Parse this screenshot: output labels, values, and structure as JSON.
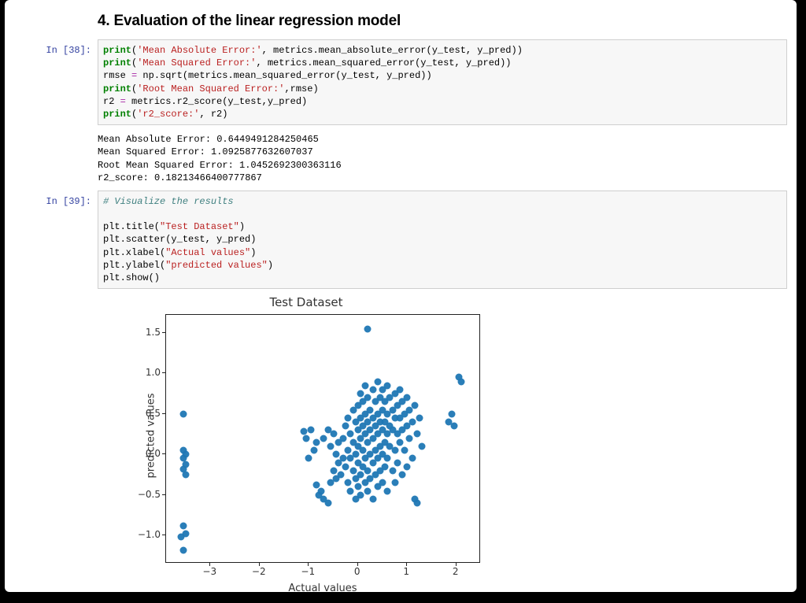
{
  "heading": "4. Evaluation of the linear regression model",
  "cells": {
    "c1": {
      "prompt": "In [38]:",
      "code_tokens": [
        {
          "t": "print",
          "c": "kw"
        },
        {
          "t": "("
        },
        {
          "t": "'Mean Absolute Error:'",
          "c": "str"
        },
        {
          "t": ", metrics.mean_absolute_error(y_test, y_pred))"
        },
        {
          "t": "\n"
        },
        {
          "t": "print",
          "c": "kw"
        },
        {
          "t": "("
        },
        {
          "t": "'Mean Squared Error:'",
          "c": "str"
        },
        {
          "t": ", metrics.mean_squared_error(y_test, y_pred))"
        },
        {
          "t": "\n"
        },
        {
          "t": "rmse "
        },
        {
          "t": "=",
          "c": "op"
        },
        {
          "t": " np.sqrt(metrics.mean_squared_error(y_test, y_pred))"
        },
        {
          "t": "\n"
        },
        {
          "t": "print",
          "c": "kw"
        },
        {
          "t": "("
        },
        {
          "t": "'Root Mean Squared Error:'",
          "c": "str"
        },
        {
          "t": ",rmse)"
        },
        {
          "t": "\n"
        },
        {
          "t": "r2 "
        },
        {
          "t": "=",
          "c": "op"
        },
        {
          "t": " metrics.r2_score(y_test,y_pred)"
        },
        {
          "t": "\n"
        },
        {
          "t": "print",
          "c": "kw"
        },
        {
          "t": "("
        },
        {
          "t": "'r2_score:'",
          "c": "str"
        },
        {
          "t": ", r2)"
        }
      ],
      "output_text": "Mean Absolute Error: 0.6449491284250465\nMean Squared Error: 1.0925877632607037\nRoot Mean Squared Error: 1.0452692300363116\nr2_score: 0.18213466400777867"
    },
    "c2": {
      "prompt": "In [39]:",
      "code_tokens": [
        {
          "t": "# Visualize the results",
          "c": "cmt"
        },
        {
          "t": "\n\n"
        },
        {
          "t": "plt.title("
        },
        {
          "t": "\"Test Dataset\"",
          "c": "str"
        },
        {
          "t": ")"
        },
        {
          "t": "\n"
        },
        {
          "t": "plt.scatter(y_test, y_pred)"
        },
        {
          "t": "\n"
        },
        {
          "t": "plt.xlabel("
        },
        {
          "t": "\"Actual values\"",
          "c": "str"
        },
        {
          "t": ")"
        },
        {
          "t": "\n"
        },
        {
          "t": "plt.ylabel("
        },
        {
          "t": "\"predicted values\"",
          "c": "str"
        },
        {
          "t": ")"
        },
        {
          "t": "\n"
        },
        {
          "t": "plt.show()"
        }
      ]
    }
  },
  "chart_data": {
    "type": "scatter",
    "title": "Test Dataset",
    "xlabel": "Actual values",
    "ylabel": "predicted values",
    "xlim": [
      -3.9,
      2.5
    ],
    "ylim": [
      -1.35,
      1.72
    ],
    "xticks": [
      -3,
      -2,
      -1,
      0,
      1,
      2
    ],
    "yticks": [
      -1.0,
      -0.5,
      0.0,
      0.5,
      1.0,
      1.5
    ],
    "points": [
      [
        0.2,
        1.55
      ],
      [
        -3.55,
        0.5
      ],
      [
        -3.55,
        0.05
      ],
      [
        -3.5,
        0.0
      ],
      [
        -3.55,
        -0.05
      ],
      [
        -3.5,
        -0.12
      ],
      [
        -3.55,
        -0.18
      ],
      [
        -3.5,
        -0.25
      ],
      [
        -3.55,
        -0.88
      ],
      [
        -3.5,
        -0.98
      ],
      [
        -3.6,
        -1.02
      ],
      [
        -3.55,
        -1.18
      ],
      [
        -1.1,
        0.28
      ],
      [
        -1.05,
        0.2
      ],
      [
        -0.95,
        0.3
      ],
      [
        -0.9,
        0.05
      ],
      [
        -1.0,
        -0.05
      ],
      [
        -0.85,
        0.15
      ],
      [
        -0.85,
        -0.38
      ],
      [
        -0.8,
        -0.5
      ],
      [
        -0.75,
        -0.45
      ],
      [
        -0.7,
        -0.55
      ],
      [
        -0.6,
        -0.6
      ],
      [
        -0.55,
        -0.35
      ],
      [
        -0.7,
        0.2
      ],
      [
        -0.6,
        0.3
      ],
      [
        -0.55,
        0.1
      ],
      [
        -0.5,
        0.25
      ],
      [
        -0.45,
        0.0
      ],
      [
        -0.4,
        0.15
      ],
      [
        -0.5,
        -0.2
      ],
      [
        -0.45,
        -0.3
      ],
      [
        -0.4,
        -0.1
      ],
      [
        -0.35,
        -0.25
      ],
      [
        -0.3,
        0.2
      ],
      [
        -0.3,
        -0.05
      ],
      [
        -0.25,
        0.35
      ],
      [
        -0.25,
        -0.15
      ],
      [
        -0.2,
        0.45
      ],
      [
        -0.2,
        0.05
      ],
      [
        -0.2,
        -0.35
      ],
      [
        -0.15,
        0.25
      ],
      [
        -0.15,
        -0.05
      ],
      [
        -0.15,
        -0.45
      ],
      [
        -0.1,
        0.55
      ],
      [
        -0.1,
        0.15
      ],
      [
        -0.1,
        -0.2
      ],
      [
        -0.05,
        0.4
      ],
      [
        -0.05,
        0.0
      ],
      [
        -0.05,
        -0.3
      ],
      [
        -0.05,
        -0.55
      ],
      [
        0.0,
        0.6
      ],
      [
        0.0,
        0.3
      ],
      [
        0.0,
        0.1
      ],
      [
        0.0,
        -0.1
      ],
      [
        0.0,
        -0.4
      ],
      [
        0.05,
        0.75
      ],
      [
        0.05,
        0.45
      ],
      [
        0.05,
        0.2
      ],
      [
        0.05,
        -0.25
      ],
      [
        0.05,
        -0.5
      ],
      [
        0.1,
        0.65
      ],
      [
        0.1,
        0.35
      ],
      [
        0.1,
        0.05
      ],
      [
        0.1,
        -0.15
      ],
      [
        0.15,
        0.85
      ],
      [
        0.15,
        0.5
      ],
      [
        0.15,
        0.25
      ],
      [
        0.15,
        -0.05
      ],
      [
        0.15,
        -0.35
      ],
      [
        0.2,
        0.7
      ],
      [
        0.2,
        0.4
      ],
      [
        0.2,
        0.15
      ],
      [
        0.2,
        -0.2
      ],
      [
        0.2,
        -0.45
      ],
      [
        0.25,
        0.55
      ],
      [
        0.25,
        0.3
      ],
      [
        0.25,
        0.0
      ],
      [
        0.25,
        -0.3
      ],
      [
        0.3,
        0.8
      ],
      [
        0.3,
        0.45
      ],
      [
        0.3,
        0.2
      ],
      [
        0.3,
        -0.1
      ],
      [
        0.3,
        -0.55
      ],
      [
        0.35,
        0.65
      ],
      [
        0.35,
        0.35
      ],
      [
        0.35,
        0.05
      ],
      [
        0.35,
        -0.25
      ],
      [
        0.4,
        0.9
      ],
      [
        0.4,
        0.5
      ],
      [
        0.4,
        0.25
      ],
      [
        0.4,
        -0.05
      ],
      [
        0.4,
        -0.4
      ],
      [
        0.45,
        0.7
      ],
      [
        0.45,
        0.4
      ],
      [
        0.45,
        0.1
      ],
      [
        0.45,
        -0.2
      ],
      [
        0.5,
        0.8
      ],
      [
        0.5,
        0.55
      ],
      [
        0.5,
        0.3
      ],
      [
        0.5,
        0.0
      ],
      [
        0.5,
        -0.35
      ],
      [
        0.55,
        0.65
      ],
      [
        0.55,
        0.4
      ],
      [
        0.55,
        0.15
      ],
      [
        0.55,
        -0.15
      ],
      [
        0.6,
        0.85
      ],
      [
        0.6,
        0.5
      ],
      [
        0.6,
        0.25
      ],
      [
        0.6,
        -0.05
      ],
      [
        0.6,
        -0.45
      ],
      [
        0.65,
        0.7
      ],
      [
        0.65,
        0.35
      ],
      [
        0.65,
        0.1
      ],
      [
        0.7,
        0.55
      ],
      [
        0.7,
        0.3
      ],
      [
        0.7,
        -0.2
      ],
      [
        0.75,
        0.75
      ],
      [
        0.75,
        0.45
      ],
      [
        0.75,
        0.05
      ],
      [
        0.75,
        -0.35
      ],
      [
        0.8,
        0.6
      ],
      [
        0.8,
        0.25
      ],
      [
        0.8,
        -0.1
      ],
      [
        0.85,
        0.8
      ],
      [
        0.85,
        0.45
      ],
      [
        0.85,
        0.15
      ],
      [
        0.9,
        0.65
      ],
      [
        0.9,
        0.3
      ],
      [
        0.9,
        -0.25
      ],
      [
        0.95,
        0.5
      ],
      [
        0.95,
        0.05
      ],
      [
        1.0,
        0.7
      ],
      [
        1.0,
        0.35
      ],
      [
        1.0,
        -0.15
      ],
      [
        1.05,
        0.55
      ],
      [
        1.05,
        0.2
      ],
      [
        1.1,
        0.4
      ],
      [
        1.1,
        -0.05
      ],
      [
        1.15,
        0.6
      ],
      [
        1.15,
        -0.55
      ],
      [
        1.2,
        0.25
      ],
      [
        1.2,
        -0.6
      ],
      [
        1.25,
        0.45
      ],
      [
        1.3,
        0.1
      ],
      [
        1.85,
        0.4
      ],
      [
        1.9,
        0.5
      ],
      [
        1.95,
        0.35
      ],
      [
        2.05,
        0.95
      ],
      [
        2.1,
        0.9
      ]
    ]
  }
}
